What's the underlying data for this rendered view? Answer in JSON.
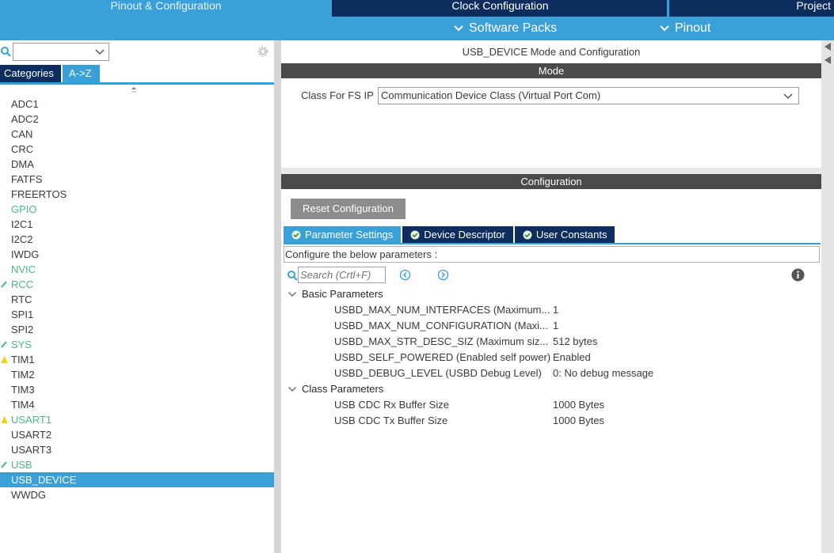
{
  "top_tabs": {
    "pinout": "Pinout & Configuration",
    "clock": "Clock Configuration",
    "project": "Project"
  },
  "sub_menu": {
    "software_packs": "Software Packs",
    "pinout": "Pinout"
  },
  "left": {
    "categories_label": "Categories",
    "az_label": "A->Z",
    "select_value": "",
    "items": [
      {
        "label": "ADC1",
        "status": "normal"
      },
      {
        "label": "ADC2",
        "status": "normal"
      },
      {
        "label": "CAN",
        "status": "normal"
      },
      {
        "label": "CRC",
        "status": "normal"
      },
      {
        "label": "DMA",
        "status": "normal"
      },
      {
        "label": "FATFS",
        "status": "normal"
      },
      {
        "label": "FREERTOS",
        "status": "normal"
      },
      {
        "label": "GPIO",
        "status": "green"
      },
      {
        "label": "I2C1",
        "status": "normal"
      },
      {
        "label": "I2C2",
        "status": "normal"
      },
      {
        "label": "IWDG",
        "status": "normal"
      },
      {
        "label": "NVIC",
        "status": "green"
      },
      {
        "label": "RCC",
        "status": "green-check"
      },
      {
        "label": "RTC",
        "status": "normal"
      },
      {
        "label": "SPI1",
        "status": "normal"
      },
      {
        "label": "SPI2",
        "status": "normal"
      },
      {
        "label": "SYS",
        "status": "green-check"
      },
      {
        "label": "TIM1",
        "status": "warning"
      },
      {
        "label": "TIM2",
        "status": "normal"
      },
      {
        "label": "TIM3",
        "status": "normal"
      },
      {
        "label": "TIM4",
        "status": "normal"
      },
      {
        "label": "USART1",
        "status": "green-warning"
      },
      {
        "label": "USART2",
        "status": "normal"
      },
      {
        "label": "USART3",
        "status": "normal"
      },
      {
        "label": "USB",
        "status": "green-check"
      },
      {
        "label": "USB_DEVICE",
        "status": "selected"
      },
      {
        "label": "WWDG",
        "status": "normal"
      }
    ]
  },
  "mode": {
    "title": "USB_DEVICE Mode and Configuration",
    "header": "Mode",
    "class_label": "Class For FS IP",
    "class_value": "Communication Device Class (Virtual Port Com)"
  },
  "config": {
    "header": "Configuration",
    "reset_label": "Reset Configuration",
    "tabs": [
      "Parameter Settings",
      "Device Descriptor",
      "User Constants"
    ],
    "instructions": "Configure the below parameters :",
    "search_placeholder": "Search (Crtl+F)",
    "groups": [
      {
        "name": "Basic Parameters",
        "params": [
          {
            "name": "USBD_MAX_NUM_INTERFACES (Maximum...",
            "value": "1"
          },
          {
            "name": "USBD_MAX_NUM_CONFIGURATION (Maxi...",
            "value": "1"
          },
          {
            "name": "USBD_MAX_STR_DESC_SIZ (Maximum siz...",
            "value": "512 bytes"
          },
          {
            "name": "USBD_SELF_POWERED (Enabled self power)",
            "value": "Enabled"
          },
          {
            "name": "USBD_DEBUG_LEVEL (USBD Debug Level)",
            "value": "0: No debug message"
          }
        ]
      },
      {
        "name": "Class Parameters",
        "params": [
          {
            "name": "USB CDC Rx Buffer Size",
            "value": "1000 Bytes"
          },
          {
            "name": "USB CDC Tx Buffer Size",
            "value": "1000 Bytes"
          }
        ]
      }
    ]
  },
  "colors": {
    "accent": "#3aa0d8",
    "navy": "#0d2d5e",
    "green": "#4cb880",
    "warning": "#f0d000",
    "header_gray": "#4a4a4a"
  }
}
